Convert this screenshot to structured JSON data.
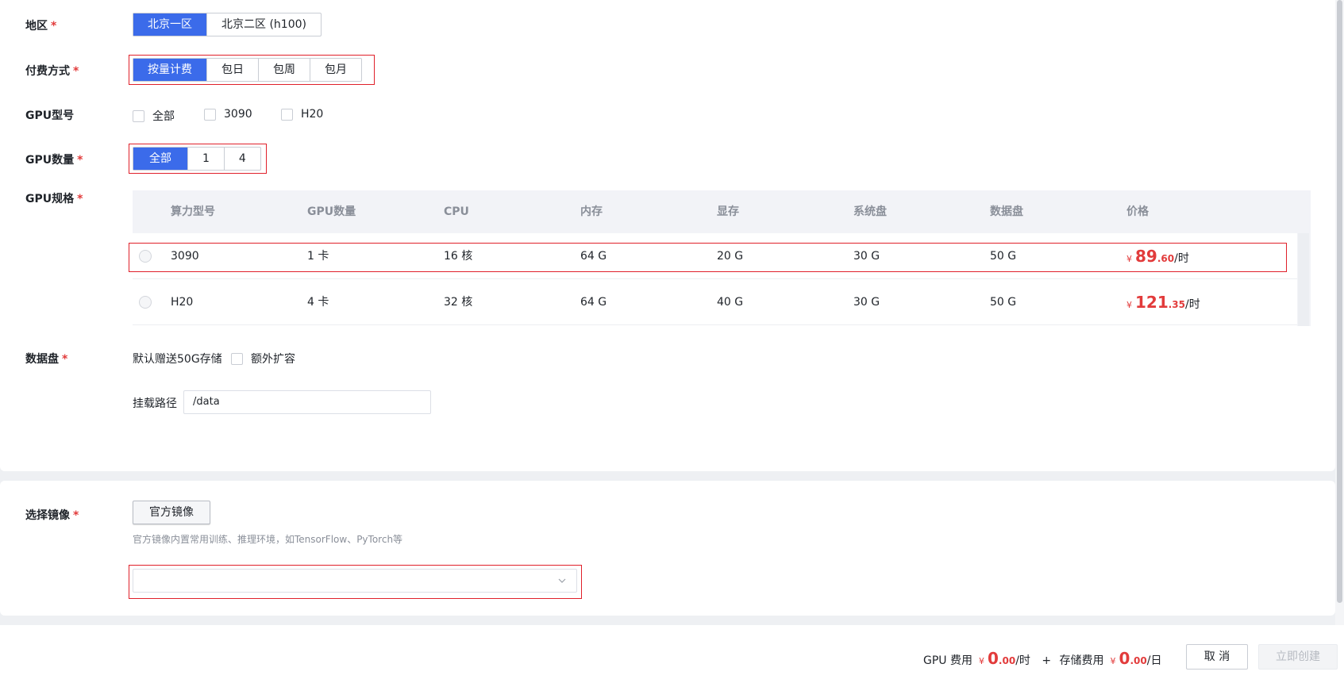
{
  "form": {
    "region": {
      "label": "地区",
      "required": "*",
      "options": [
        "北京一区",
        "北京二区 (h100)"
      ],
      "selected": "北京一区"
    },
    "billing": {
      "label": "付费方式",
      "required": "*",
      "options": [
        "按量计费",
        "包日",
        "包周",
        "包月"
      ],
      "selected": "按量计费"
    },
    "gpu_model": {
      "label": "GPU型号",
      "options": [
        "全部",
        "3090",
        "H20"
      ]
    },
    "gpu_count": {
      "label": "GPU数量",
      "required": "*",
      "options": [
        "全部",
        "1",
        "4"
      ],
      "selected": "全部"
    },
    "gpu_spec": {
      "label": "GPU规格",
      "required": "*",
      "columns": [
        "算力型号",
        "GPU数量",
        "CPU",
        "内存",
        "显存",
        "系统盘",
        "数据盘",
        "价格"
      ],
      "rows": [
        {
          "model": "3090",
          "gpu": "1 卡",
          "cpu": "16 核",
          "mem": "64 G",
          "vram": "20 G",
          "sys": "30 G",
          "data": "50 G",
          "currency": "¥",
          "price_int": "89",
          "price_dec": ".60",
          "unit": "/时"
        },
        {
          "model": "H20",
          "gpu": "4 卡",
          "cpu": "32 核",
          "mem": "64 G",
          "vram": "40 G",
          "sys": "30 G",
          "data": "50 G",
          "currency": "¥",
          "price_int": "121",
          "price_dec": ".35",
          "unit": "/时"
        }
      ]
    },
    "data_disk": {
      "label": "数据盘",
      "required": "*",
      "default_text": "默认赠送50G存储",
      "extra_label": "额外扩容",
      "mount_label": "挂载路径",
      "mount_value": "/data"
    },
    "image": {
      "label": "选择镜像",
      "required": "*",
      "button": "官方镜像",
      "hint": "官方镜像内置常用训练、推理环境，如TensorFlow、PyTorch等",
      "select_value": "",
      "chevron_icon": "chevron-down-icon"
    }
  },
  "footer": {
    "gpu_fee_label": "GPU 费用",
    "gpu_fee_currency": "¥",
    "gpu_fee_int": "0",
    "gpu_fee_dec": ".00",
    "gpu_fee_unit": "/时",
    "plus": "+",
    "storage_fee_label": "存储费用",
    "storage_fee_currency": "¥",
    "storage_fee_int": "0",
    "storage_fee_dec": ".00",
    "storage_fee_unit": "/日",
    "cancel": "取 消",
    "create": "立即创建"
  },
  "colors": {
    "primary": "#3b6bea",
    "price": "#e23b3b",
    "highlight_box": "#e0202a"
  }
}
